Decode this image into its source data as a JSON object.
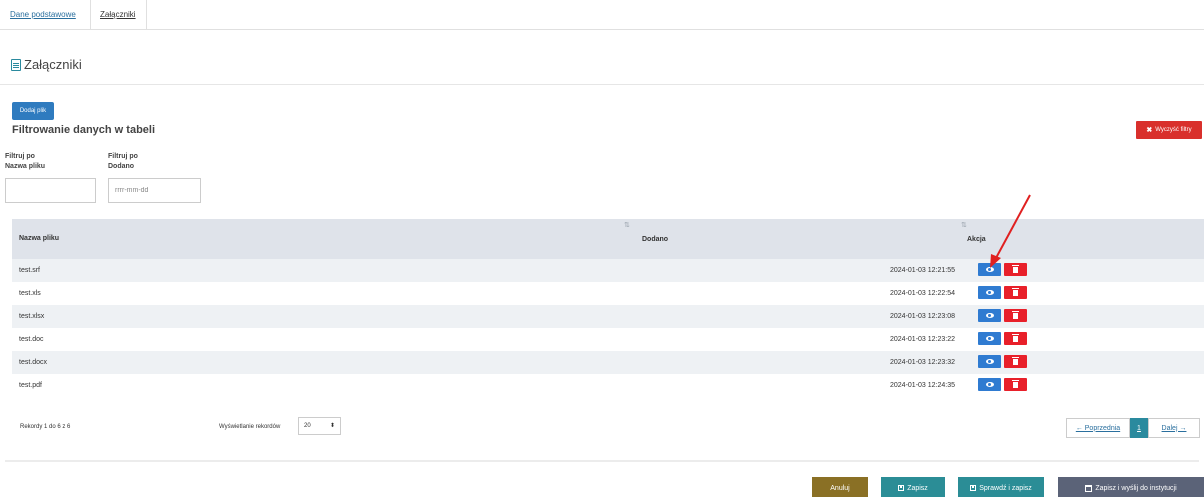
{
  "tabs": [
    {
      "label": "Dane podstawowe"
    },
    {
      "label": "Załączniki"
    }
  ],
  "section": {
    "title": "Załączniki"
  },
  "add_button": {
    "label": "Dodaj plik"
  },
  "filter": {
    "title": "Filtrowanie danych w tabeli",
    "clear_label": "Wyczyść filtry",
    "fields": [
      {
        "label_line1": "Filtruj po",
        "label_line2": "Nazwa pliku",
        "placeholder": "",
        "value": ""
      },
      {
        "label_line1": "Filtruj po",
        "label_line2": "Dodano",
        "placeholder": "rrrr-mm-dd",
        "value": ""
      }
    ]
  },
  "table": {
    "headers": {
      "name": "Nazwa pliku",
      "added": "Dodano",
      "action": "Akcja"
    },
    "rows": [
      {
        "name": "test.srf",
        "date": "2024-01-03 12:21:55"
      },
      {
        "name": "test.xls",
        "date": "2024-01-03 12:22:54"
      },
      {
        "name": "test.xlsx",
        "date": "2024-01-03 12:23:08"
      },
      {
        "name": "test.doc",
        "date": "2024-01-03 12:23:22"
      },
      {
        "name": "test.docx",
        "date": "2024-01-03 12:23:32"
      },
      {
        "name": "test.pdf",
        "date": "2024-01-03 12:24:35"
      }
    ]
  },
  "pagination": {
    "records_text": "Rekordy 1 do 6 z 6",
    "per_page_label": "Wyświetlanie rekordów",
    "per_page_value": "20",
    "prev_label": "← Poprzednia",
    "current_page": "1",
    "next_label": "Dalej →"
  },
  "footer_buttons": {
    "cancel": "Anuluj",
    "save": "Zapisz",
    "check_save": "Sprawdź i zapisz",
    "save_send": "Zapisz i wyślij do instytucji"
  },
  "colors": {
    "primary": "#2f7bbf",
    "danger": "#d9302c",
    "teal": "#2b8d96",
    "annotation": "#e02020"
  }
}
